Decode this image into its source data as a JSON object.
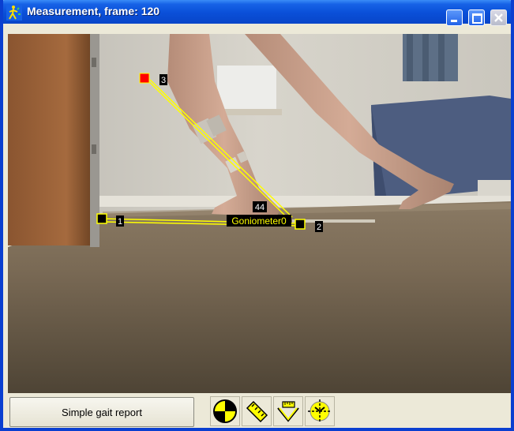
{
  "window": {
    "title": "Measurement, frame:  120",
    "app_icon": "walking-person-icon",
    "controls": [
      "minimize-icon",
      "maximize-icon",
      "close-icon"
    ]
  },
  "video": {
    "overlay": {
      "points": [
        {
          "label": "1",
          "color": "#000000"
        },
        {
          "label": "2",
          "color": "#000000"
        },
        {
          "label": "3",
          "color": "#ff0000"
        }
      ],
      "goniometer": {
        "name": "Goniometer0",
        "angle": "44"
      },
      "line_color": "#ffff00"
    }
  },
  "bottom": {
    "report_button_label": "Simple gait report",
    "tools": [
      {
        "name": "target-icon"
      },
      {
        "name": "ruler-icon"
      },
      {
        "name": "angle-measure-icon"
      },
      {
        "name": "crosshair-icon"
      }
    ]
  },
  "colors": {
    "titlebar": "#0a4fd8",
    "frame": "#0a3fd0",
    "panel": "#ece9d8"
  }
}
